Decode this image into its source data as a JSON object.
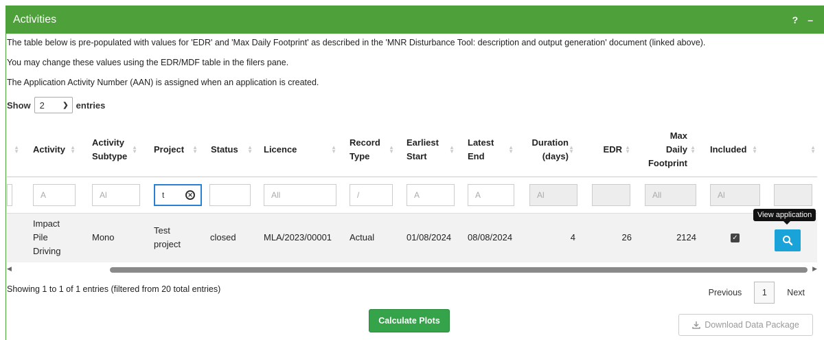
{
  "panel": {
    "title": "Activities",
    "help_label": "?",
    "collapse_label": "–"
  },
  "description": {
    "line1": "The table below is pre-populated with values for 'EDR' and 'Max Daily Footprint' as described in the 'MNR Disturbance Tool: description and output generation' document (linked above).",
    "line2": "You may change these values using the EDR/MDF table in the filers pane.",
    "line3": "The Application Activity Number (AAN) is assigned when an application is created."
  },
  "length_menu": {
    "show_label": "Show",
    "selected": "2",
    "entries_label": "entries"
  },
  "table": {
    "headers": {
      "activity": "Activity",
      "activity_subtype_1": "Activity",
      "activity_subtype_2": "Subtype",
      "project": "Project",
      "status": "Status",
      "licence": "Licence",
      "record_type_1": "Record",
      "record_type_2": "Type",
      "earliest_start_1": "Earliest",
      "earliest_start_2": "Start",
      "latest_end_1": "Latest",
      "latest_end_2": "End",
      "duration_1": "Duration",
      "duration_2": "(days)",
      "edr": "EDR",
      "max_daily_1": "Max",
      "max_daily_2": "Daily",
      "max_daily_3": "Footprint",
      "included": "Included"
    },
    "filters": {
      "first": "",
      "activity": "A",
      "subtype": "Al",
      "project": "t",
      "status": "",
      "licence": "All",
      "record_type": "/",
      "earliest_start": "A",
      "latest_end": "A",
      "duration": "Al",
      "edr": "",
      "max_daily": "All",
      "included": "Al",
      "last": ""
    },
    "row": {
      "activity_1": "Impact",
      "activity_2": "Pile",
      "activity_3": "Driving",
      "subtype": "Mono",
      "project_1": "Test",
      "project_2": "project",
      "status": "closed",
      "licence": "MLA/2023/00001",
      "record_type": "Actual",
      "earliest_start": "01/08/2024",
      "latest_end": "08/08/2024",
      "duration": "4",
      "edr": "26",
      "max_daily": "2124",
      "included": true
    },
    "tooltip": "View application"
  },
  "info_text": "Showing 1 to 1 of 1 entries (filtered from 20 total entries)",
  "pagination": {
    "previous": "Previous",
    "current_page": "1",
    "next": "Next"
  },
  "buttons": {
    "calculate": "Calculate Plots",
    "download": "Download Data Package"
  },
  "colors": {
    "header_green": "#4ea03a",
    "button_green": "#34a34a",
    "view_button_blue": "#1aa3d9"
  }
}
